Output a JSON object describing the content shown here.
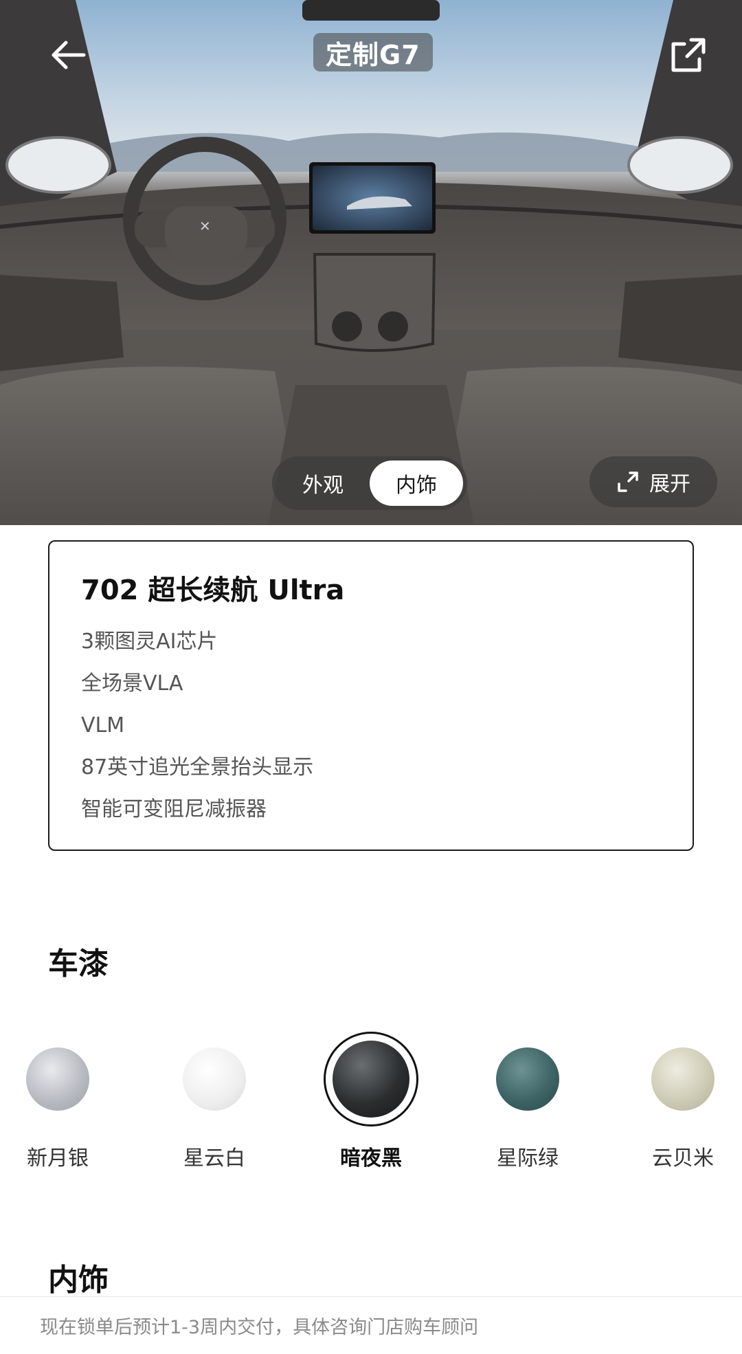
{
  "header": {
    "title": "定制G7"
  },
  "view_toggle": {
    "options": [
      "外观",
      "内饰"
    ],
    "selected": "内饰"
  },
  "expand_label": "展开",
  "spec": {
    "title": "702 超长续航 Ultra",
    "features": [
      "3颗图灵AI芯片",
      "全场景VLA",
      "VLM",
      "87英寸追光全景抬头显示",
      "智能可变阻尼减振器"
    ]
  },
  "paint": {
    "title": "车漆",
    "selected": "暗夜黑",
    "options": [
      {
        "label": "新月银",
        "color": "#b9bcc2"
      },
      {
        "label": "星云白",
        "color": "#eeeeee"
      },
      {
        "label": "暗夜黑",
        "color": "#2b2e2f"
      },
      {
        "label": "星际绿",
        "color": "#3e6466"
      },
      {
        "label": "云贝米",
        "color": "#cfccb6"
      }
    ]
  },
  "interior": {
    "title": "内饰"
  },
  "notice": "现在锁单后预计1-3周内交付，具体咨询门店购车顾问"
}
